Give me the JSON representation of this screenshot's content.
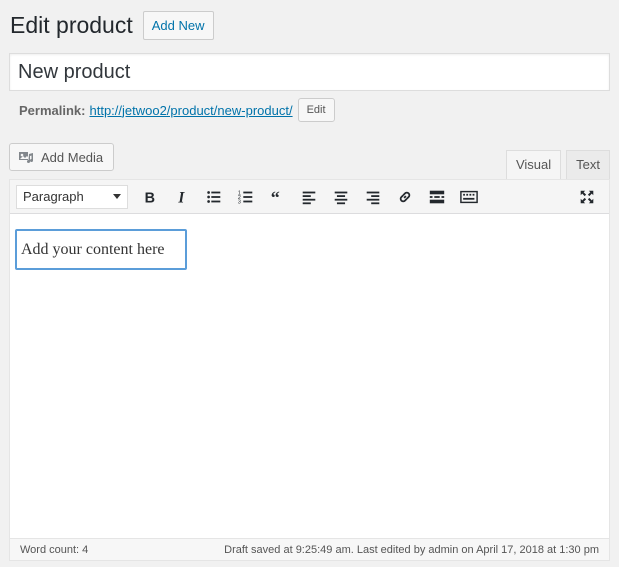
{
  "header": {
    "title": "Edit product",
    "add_new_label": "Add New"
  },
  "title_field": {
    "value": "New product"
  },
  "permalink": {
    "label": "Permalink:",
    "url_base": "http://jetwoo2/product/",
    "slug": "new-product",
    "url_suffix": "/",
    "edit_label": "Edit"
  },
  "media": {
    "add_media_label": "Add Media",
    "icon": "add-media-icon"
  },
  "tabs": [
    {
      "label": "Visual",
      "active": true
    },
    {
      "label": "Text",
      "active": false
    }
  ],
  "toolbar": {
    "format_value": "Paragraph",
    "buttons": [
      {
        "name": "bold-icon"
      },
      {
        "name": "italic-icon"
      },
      {
        "name": "bullet-list-icon"
      },
      {
        "name": "numbered-list-icon"
      },
      {
        "name": "blockquote-icon"
      },
      {
        "name": "align-left-icon"
      },
      {
        "name": "align-center-icon"
      },
      {
        "name": "align-right-icon"
      },
      {
        "name": "link-icon"
      },
      {
        "name": "read-more-icon"
      },
      {
        "name": "toolbar-toggle-icon"
      },
      {
        "name": "fullscreen-icon"
      }
    ]
  },
  "editor": {
    "placeholder": "Add your content here"
  },
  "status": {
    "word_count": "Word count: 4",
    "saved": "Draft saved at 9:25:49 am. Last edited by admin on April 17, 2018 at 1:30 pm"
  },
  "colors": {
    "link": "#0073aa",
    "focus_border": "#5b9dd9",
    "background": "#f1f1f1"
  }
}
